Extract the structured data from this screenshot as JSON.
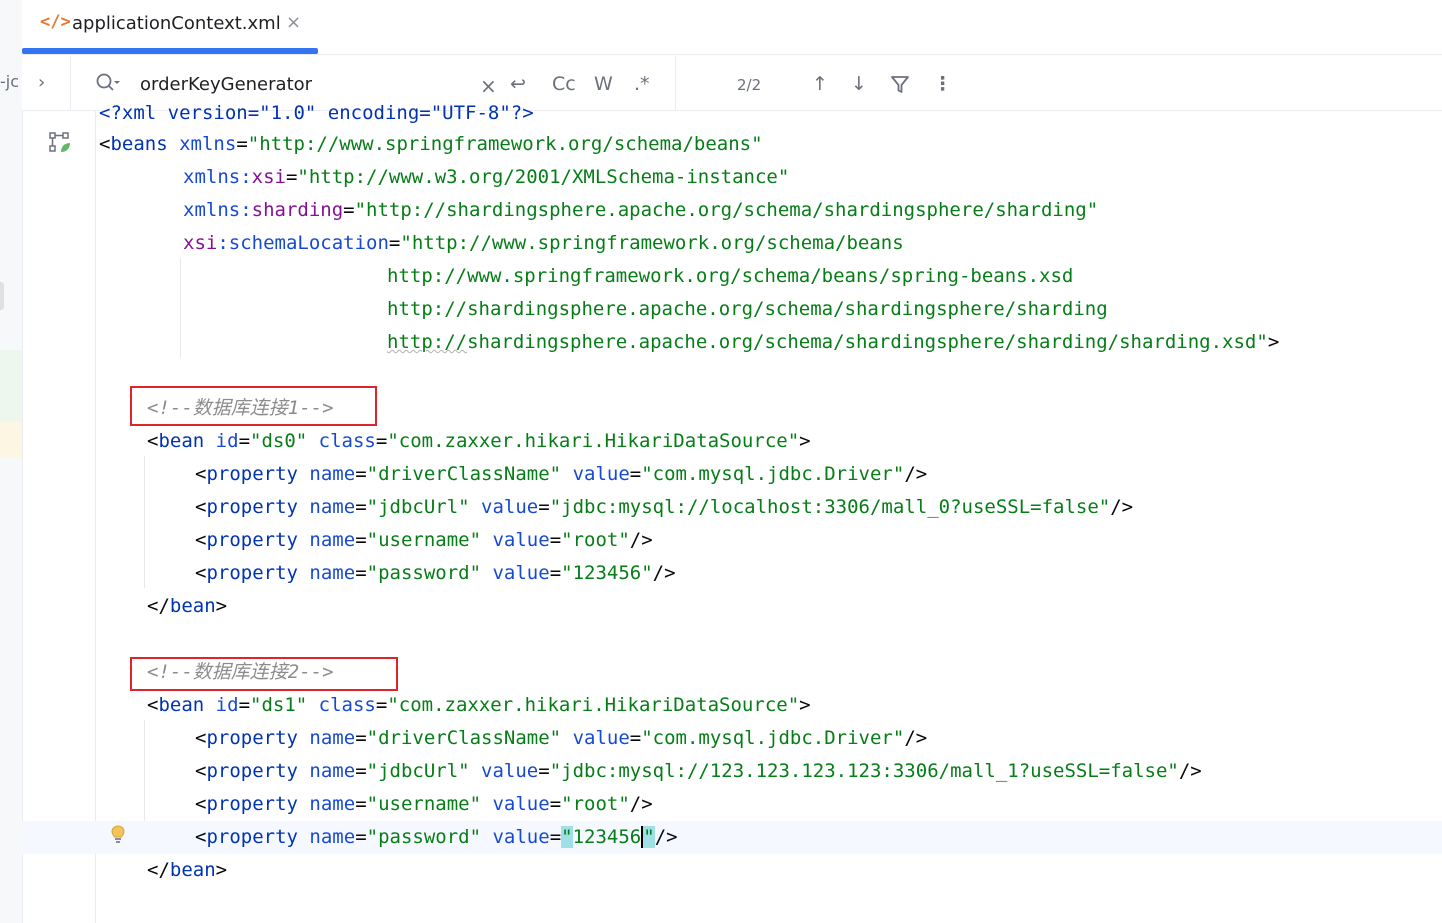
{
  "left_strip": {
    "text": "-jc"
  },
  "tab": {
    "icon": "</>",
    "title": "applicationContext.xml",
    "close": "×"
  },
  "search": {
    "chevron": "›",
    "value": "orderKeyGenerator",
    "clear": "×",
    "newline_icon": "↩",
    "match_case": "Cc",
    "words": "W",
    "regex": ".*",
    "count": "2/2",
    "prev": "↑",
    "next": "↓",
    "filter_icon": "filter-icon",
    "more": "⋮"
  },
  "code": {
    "l0": "<?xml version=\"1.0\" encoding=\"UTF-8\"?>",
    "beans_open": "<",
    "beans_tag": "beans",
    "xmlns_attr": "xmlns",
    "xmlns_val": "\"http://www.springframework.org/schema/beans\"",
    "xsi_prefix": "xmlns:",
    "xsi_name": "xsi",
    "xsi_val": "\"http://www.w3.org/2001/XMLSchema-instance\"",
    "sharding_prefix": "xmlns:",
    "sharding_name": "sharding",
    "sharding_val": "\"http://shardingsphere.apache.org/schema/shardingsphere/sharding\"",
    "schema_prefix": "xsi",
    "schema_attr": ":schemaLocation",
    "schema_val1": "\"http://www.springframework.org/schema/beans",
    "schema_val2": "http://www.springframework.org/schema/beans/spring-beans.xsd",
    "schema_val3": "http://shardingsphere.apache.org/schema/shardingsphere/sharding",
    "schema_val4_wavy": "http://",
    "schema_val4_rest": "shardingsphere.apache.org/schema/shardingsphere/sharding/sharding.xsd\"",
    "close_gt": ">",
    "comment1_a": "<!--",
    "comment1_cjk": "数据库连接",
    "comment1_b": "1-->",
    "comment2_a": "<!--",
    "comment2_cjk": "数据库连接",
    "comment2_b": "2-->",
    "bean_tag": "bean",
    "id_attr": "id",
    "ds0": "\"ds0\"",
    "ds1": "\"ds1\"",
    "class_attr": "class",
    "class_val": "\"com.zaxxer.hikari.HikariDataSource\"",
    "property_tag": "property",
    "name_attr": "name",
    "value_attr": "value",
    "n_driver": "\"driverClassName\"",
    "v_driver": "\"com.mysql.jdbc.Driver\"",
    "n_url": "\"jdbcUrl\"",
    "v_url0": "\"jdbc:mysql://localhost:3306/mall_0?useSSL=false\"",
    "v_url1": "\"jdbc:mysql://123.123.123.123:3306/mall_1?useSSL=false\"",
    "n_user": "\"username\"",
    "v_user": "\"root\"",
    "n_pass": "\"password\"",
    "v_pass": "\"123456\"",
    "v_pass_q1": "\"",
    "v_pass_num": "123456",
    "v_pass_q2": "\"",
    "self_close": "/>",
    "bean_close_tag": "</",
    "bean_close_end": ">"
  },
  "colors": {
    "tag": "#0033b3",
    "attr": "#174ad4",
    "namespace": "#871094",
    "value": "#067d17",
    "comment": "#8c8c8c",
    "accent": "#3574f0",
    "annotation_box": "#e0242b"
  }
}
